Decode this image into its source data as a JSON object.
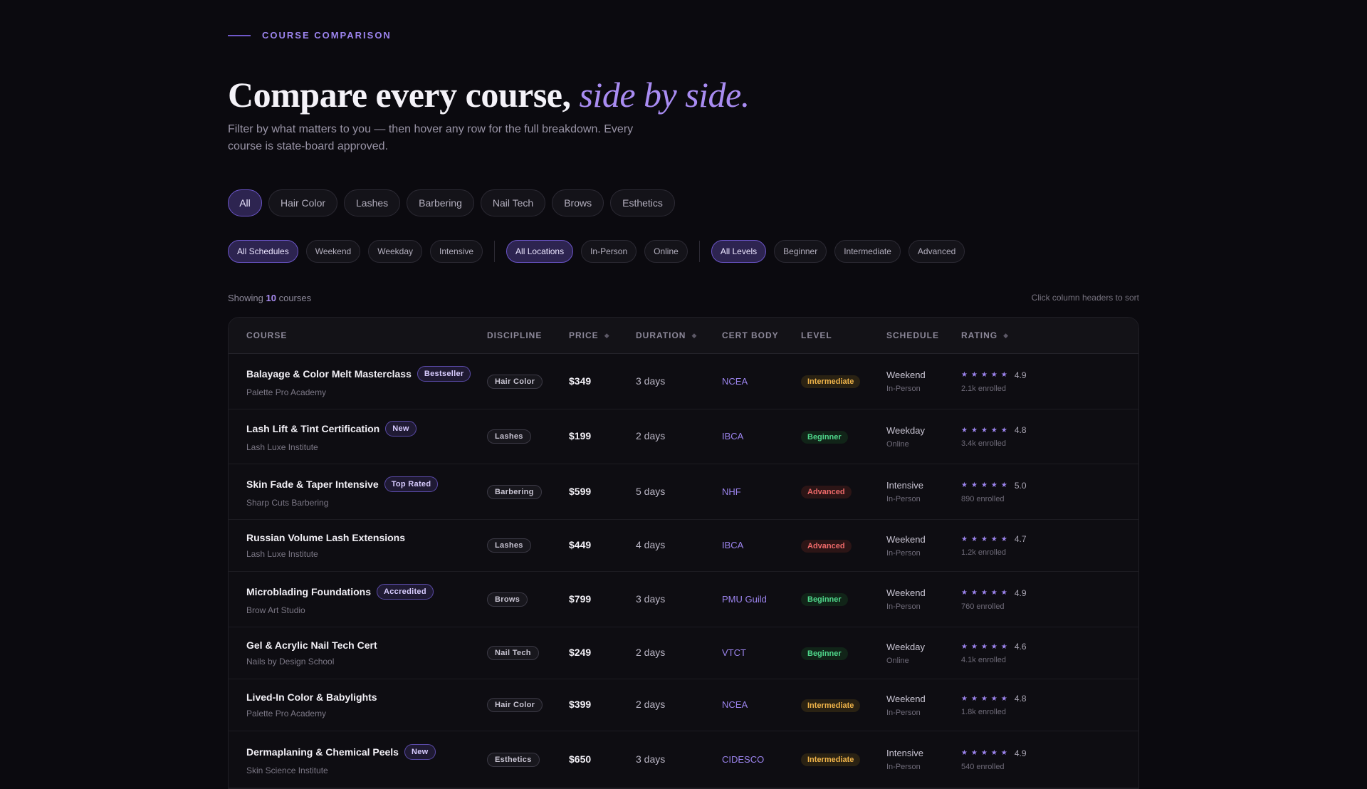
{
  "header": {
    "eyebrow": "COURSE COMPARISON",
    "title_main": "Compare every course,",
    "title_accent": "side by side.",
    "subtitle": "Filter by what matters to you — then hover any row for the full breakdown. Every course is state-board approved."
  },
  "disciplines": [
    "All",
    "Hair Color",
    "Lashes",
    "Barbering",
    "Nail Tech",
    "Brows",
    "Esthetics"
  ],
  "active_discipline": "All",
  "filters": {
    "schedules": [
      "All Schedules",
      "Weekend",
      "Weekday",
      "Intensive"
    ],
    "locations": [
      "All Locations",
      "In-Person",
      "Online"
    ],
    "levels": [
      "All Levels",
      "Beginner",
      "Intermediate",
      "Advanced"
    ]
  },
  "summary": {
    "prefix": "Showing",
    "count": "10",
    "suffix": "courses",
    "hint": "Click column headers to sort"
  },
  "columns": {
    "course": "COURSE",
    "discipline": "DISCIPLINE",
    "price": "PRICE",
    "duration": "DURATION",
    "cert": "CERT BODY",
    "level": "LEVEL",
    "schedule": "SCHEDULE",
    "rating": "RATING"
  },
  "icons": {
    "sort": "sort-icon",
    "star": "star-icon"
  },
  "colors": {
    "accent": "#9d85f0",
    "intermediate": "#f0b449",
    "beginner": "#4fd78b",
    "advanced": "#ef6a6a"
  },
  "courses": [
    {
      "name": "Balayage & Color Melt Masterclass",
      "badge": "Bestseller",
      "school": "Palette Pro Academy",
      "discipline": "Hair Color",
      "price": "$349",
      "duration": "3 days",
      "cert": "NCEA",
      "level": "Intermediate",
      "schedule": "Weekend",
      "location": "In-Person",
      "rating": "4.9",
      "enrolled": "2.1k enrolled"
    },
    {
      "name": "Lash Lift & Tint Certification",
      "badge": "New",
      "school": "Lash Luxe Institute",
      "discipline": "Lashes",
      "price": "$199",
      "duration": "2 days",
      "cert": "IBCA",
      "level": "Beginner",
      "schedule": "Weekday",
      "location": "Online",
      "rating": "4.8",
      "enrolled": "3.4k enrolled"
    },
    {
      "name": "Skin Fade & Taper Intensive",
      "badge": "Top Rated",
      "school": "Sharp Cuts Barbering",
      "discipline": "Barbering",
      "price": "$599",
      "duration": "5 days",
      "cert": "NHF",
      "level": "Advanced",
      "schedule": "Intensive",
      "location": "In-Person",
      "rating": "5.0",
      "enrolled": "890 enrolled"
    },
    {
      "name": "Russian Volume Lash Extensions",
      "badge": "",
      "school": "Lash Luxe Institute",
      "discipline": "Lashes",
      "price": "$449",
      "duration": "4 days",
      "cert": "IBCA",
      "level": "Advanced",
      "schedule": "Weekend",
      "location": "In-Person",
      "rating": "4.7",
      "enrolled": "1.2k enrolled"
    },
    {
      "name": "Microblading Foundations",
      "badge": "Accredited",
      "school": "Brow Art Studio",
      "discipline": "Brows",
      "price": "$799",
      "duration": "3 days",
      "cert": "PMU Guild",
      "level": "Beginner",
      "schedule": "Weekend",
      "location": "In-Person",
      "rating": "4.9",
      "enrolled": "760 enrolled"
    },
    {
      "name": "Gel & Acrylic Nail Tech Cert",
      "badge": "",
      "school": "Nails by Design School",
      "discipline": "Nail Tech",
      "price": "$249",
      "duration": "2 days",
      "cert": "VTCT",
      "level": "Beginner",
      "schedule": "Weekday",
      "location": "Online",
      "rating": "4.6",
      "enrolled": "4.1k enrolled"
    },
    {
      "name": "Lived-In Color & Babylights",
      "badge": "",
      "school": "Palette Pro Academy",
      "discipline": "Hair Color",
      "price": "$399",
      "duration": "2 days",
      "cert": "NCEA",
      "level": "Intermediate",
      "schedule": "Weekend",
      "location": "In-Person",
      "rating": "4.8",
      "enrolled": "1.8k enrolled"
    },
    {
      "name": "Dermaplaning & Chemical Peels",
      "badge": "New",
      "school": "Skin Science Institute",
      "discipline": "Esthetics",
      "price": "$650",
      "duration": "3 days",
      "cert": "CIDESCO",
      "level": "Intermediate",
      "schedule": "Intensive",
      "location": "In-Person",
      "rating": "4.9",
      "enrolled": "540 enrolled"
    }
  ]
}
